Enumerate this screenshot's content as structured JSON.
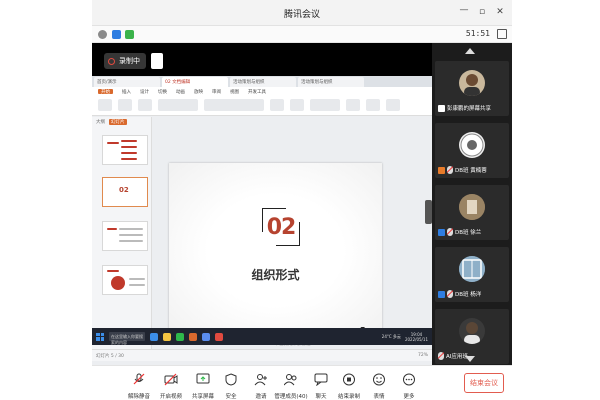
{
  "window": {
    "title": "腾讯会议"
  },
  "statusbar": {
    "timer": "51:51"
  },
  "recording": {
    "label": "录制中"
  },
  "ppt": {
    "tabs": [
      "首页/演示",
      "02 文档编辑",
      "活动策划与组织",
      "活动策划与组织"
    ],
    "menu": [
      "开始",
      "插入",
      "设计",
      "切换",
      "动画",
      "放映",
      "审阅",
      "视图",
      "开发工具"
    ],
    "sidebar_tabs": [
      "大纲",
      "幻灯片"
    ],
    "slide_number": "02",
    "slide_title": "组织形式",
    "note_placeholder": "单击此处添加备注",
    "status_left": "幻灯片 5 / 30",
    "status_right": "72%"
  },
  "taskbar": {
    "search": "在这里输入你要搜索的内容",
    "weather": "24°C 多云",
    "time": "19:04",
    "date": "2022/05/11"
  },
  "participants": [
    {
      "name": "彭康鹏的屏幕共享",
      "badge_color": "#ffffff"
    },
    {
      "name": "DB班 黄楠蓉",
      "badge_color": "#e87b2a"
    },
    {
      "name": "DB班 徐兰",
      "badge_color": "#2e7de1"
    },
    {
      "name": "DB班 杨洋",
      "badge_color": "#2e7de1"
    },
    {
      "name": "AI应用班",
      "badge_color": "#e87b2a"
    }
  ],
  "toolbar": {
    "items": [
      {
        "label": "解除静音",
        "icon": "microphone-muted-icon"
      },
      {
        "label": "开启视频",
        "icon": "camera-off-icon"
      },
      {
        "label": "共享屏幕",
        "icon": "share-screen-icon"
      },
      {
        "label": "安全",
        "icon": "shield-icon"
      },
      {
        "label": "邀请",
        "icon": "invite-icon"
      },
      {
        "label": "管理成员(40)",
        "icon": "members-icon"
      },
      {
        "label": "聊天",
        "icon": "chat-icon"
      },
      {
        "label": "结束录制",
        "icon": "stop-record-icon"
      },
      {
        "label": "表情",
        "icon": "emoji-icon"
      },
      {
        "label": "更多",
        "icon": "more-icon"
      }
    ],
    "end_meeting": "结束会议"
  },
  "colors": {
    "accent_red": "#e25c4f",
    "slide_red": "#b6432f"
  }
}
